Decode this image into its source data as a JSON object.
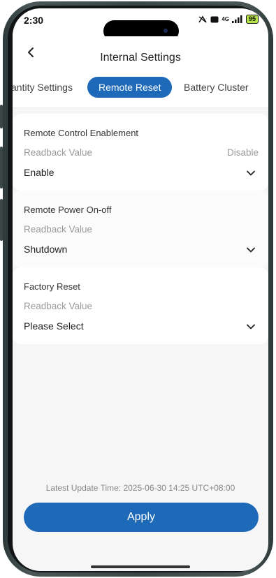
{
  "status": {
    "time": "2:30",
    "network": "4G",
    "battery": "95"
  },
  "header": {
    "title": "Internal Settings"
  },
  "tabs": [
    {
      "label": "antity Settings"
    },
    {
      "label": "Remote Reset",
      "active": true
    },
    {
      "label": "Battery Cluster"
    }
  ],
  "cards": [
    {
      "label": "Remote Control Enablement",
      "readback_label": "Readback Value",
      "readback_value": "Disable",
      "selected": "Enable"
    },
    {
      "label": "Remote Power On-off",
      "readback_label": "Readback Value",
      "readback_value": "",
      "selected": "Shutdown"
    },
    {
      "label": "Factory Reset",
      "readback_label": "Readback Value",
      "readback_value": "",
      "selected": "Please Select"
    }
  ],
  "footer": {
    "update_time": "Latest Update Time: 2025-06-30 14:25 UTC+08:00",
    "apply_label": "Apply"
  },
  "colors": {
    "accent": "#1e69b8",
    "background": "#f6f6f6"
  }
}
